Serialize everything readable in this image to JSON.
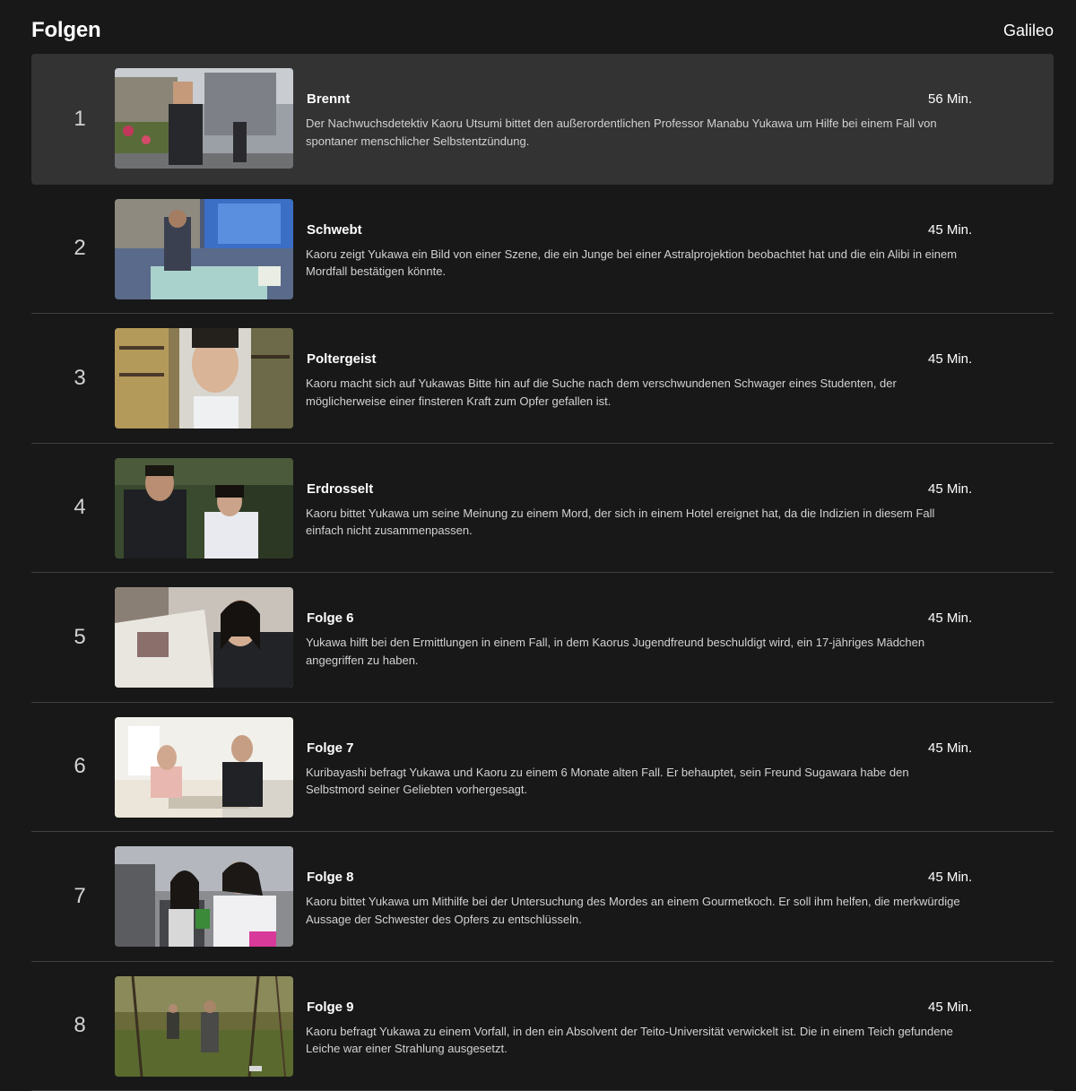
{
  "header": {
    "title": "Folgen",
    "show_name": "Galileo"
  },
  "episodes": [
    {
      "index": "1",
      "title": "Brennt",
      "duration": "56 Min.",
      "description": "Der Nachwuchsdetektiv Kaoru Utsumi bittet den außerordentlichen Professor Manabu Yukawa um Hilfe bei einem Fall von spontaner menschlicher Selbstentzündung."
    },
    {
      "index": "2",
      "title": "Schwebt",
      "duration": "45 Min.",
      "description": "Kaoru zeigt Yukawa ein Bild von einer Szene, die ein Junge bei einer Astralprojektion beobachtet hat und die ein Alibi in einem Mordfall bestätigen könnte."
    },
    {
      "index": "3",
      "title": "Poltergeist",
      "duration": "45 Min.",
      "description": "Kaoru macht sich auf Yukawas Bitte hin auf die Suche nach dem verschwundenen Schwager eines Studenten, der möglicherweise einer finsteren Kraft zum Opfer gefallen ist."
    },
    {
      "index": "4",
      "title": "Erdrosselt",
      "duration": "45 Min.",
      "description": "Kaoru bittet Yukawa um seine Meinung zu einem Mord, der sich in einem Hotel ereignet hat, da die Indizien in diesem Fall einfach nicht zusammenpassen."
    },
    {
      "index": "5",
      "title": "Folge 6",
      "duration": "45 Min.",
      "description": "Yukawa hilft bei den Ermittlungen in einem Fall, in dem Kaorus Jugendfreund beschuldigt wird, ein 17-jähriges Mädchen angegriffen zu haben."
    },
    {
      "index": "6",
      "title": "Folge 7",
      "duration": "45 Min.",
      "description": "Kuribayashi befragt Yukawa und Kaoru zu einem 6 Monate alten Fall. Er behauptet, sein Freund Sugawara habe den Selbstmord seiner Geliebten vorhergesagt."
    },
    {
      "index": "7",
      "title": "Folge 8",
      "duration": "45 Min.",
      "description": "Kaoru bittet Yukawa um Mithilfe bei der Untersuchung des Mordes an einem Gourmetkoch. Er soll ihm helfen, die merkwürdige Aussage der Schwester des Opfers zu entschlüsseln."
    },
    {
      "index": "8",
      "title": "Folge 9",
      "duration": "45 Min.",
      "description": "Kaoru befragt Yukawa zu einem Vorfall, in den ein Absolvent der Teito-Universität verwickelt ist. Die in einem Teich gefundene Leiche war einer Strahlung ausgesetzt."
    }
  ],
  "colors": {
    "background": "#181818",
    "active_row": "#333333",
    "divider": "#404040",
    "secondary_text": "#d2d2d2"
  }
}
